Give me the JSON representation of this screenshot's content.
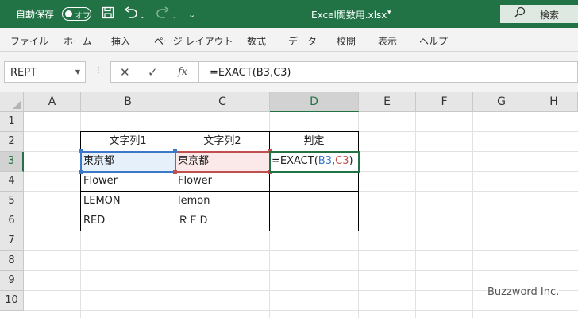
{
  "titlebar": {
    "autosave_label": "自動保存",
    "autosave_state": "オフ",
    "filename": "Excel関数用.xlsx",
    "search_label": "検索"
  },
  "ribbon": {
    "tabs": [
      "ファイル",
      "ホーム",
      "挿入",
      "ページ レイアウト",
      "数式",
      "データ",
      "校閲",
      "表示",
      "ヘルプ"
    ]
  },
  "formula_bar": {
    "name_box": "REPT",
    "formula": "=EXACT(B3,C3)"
  },
  "grid": {
    "columns": [
      "A",
      "B",
      "C",
      "D",
      "E",
      "F",
      "G",
      "H"
    ],
    "rows": [
      "1",
      "2",
      "3",
      "4",
      "5",
      "6",
      "7",
      "8",
      "9",
      "10"
    ],
    "selected_column": "D",
    "selected_row": "3"
  },
  "table": {
    "headers": [
      "文字列1",
      "文字列2",
      "判定"
    ],
    "rows": [
      [
        "東京都",
        "東京都",
        ""
      ],
      [
        "Flower",
        "Flower",
        ""
      ],
      [
        "LEMON",
        "lemon",
        ""
      ],
      [
        "RED",
        "ＲＥＤ",
        ""
      ]
    ],
    "editing_formula": {
      "prefix": "=EXACT(",
      "ref1": "B3",
      "sep": ",",
      "ref2": "C3",
      "suffix": ")"
    }
  },
  "watermark": "Buzzword Inc.",
  "colors": {
    "excel_green": "#217346",
    "ref_blue": "#3c78c8",
    "ref_red": "#c0504d"
  },
  "icons": {
    "save": "save-icon",
    "undo": "undo-icon",
    "redo": "redo-icon",
    "customize": "customize-qat-icon",
    "search": "search-icon",
    "cancel": "cancel-icon",
    "enter": "checkmark-icon",
    "function": "insert-function-icon"
  }
}
